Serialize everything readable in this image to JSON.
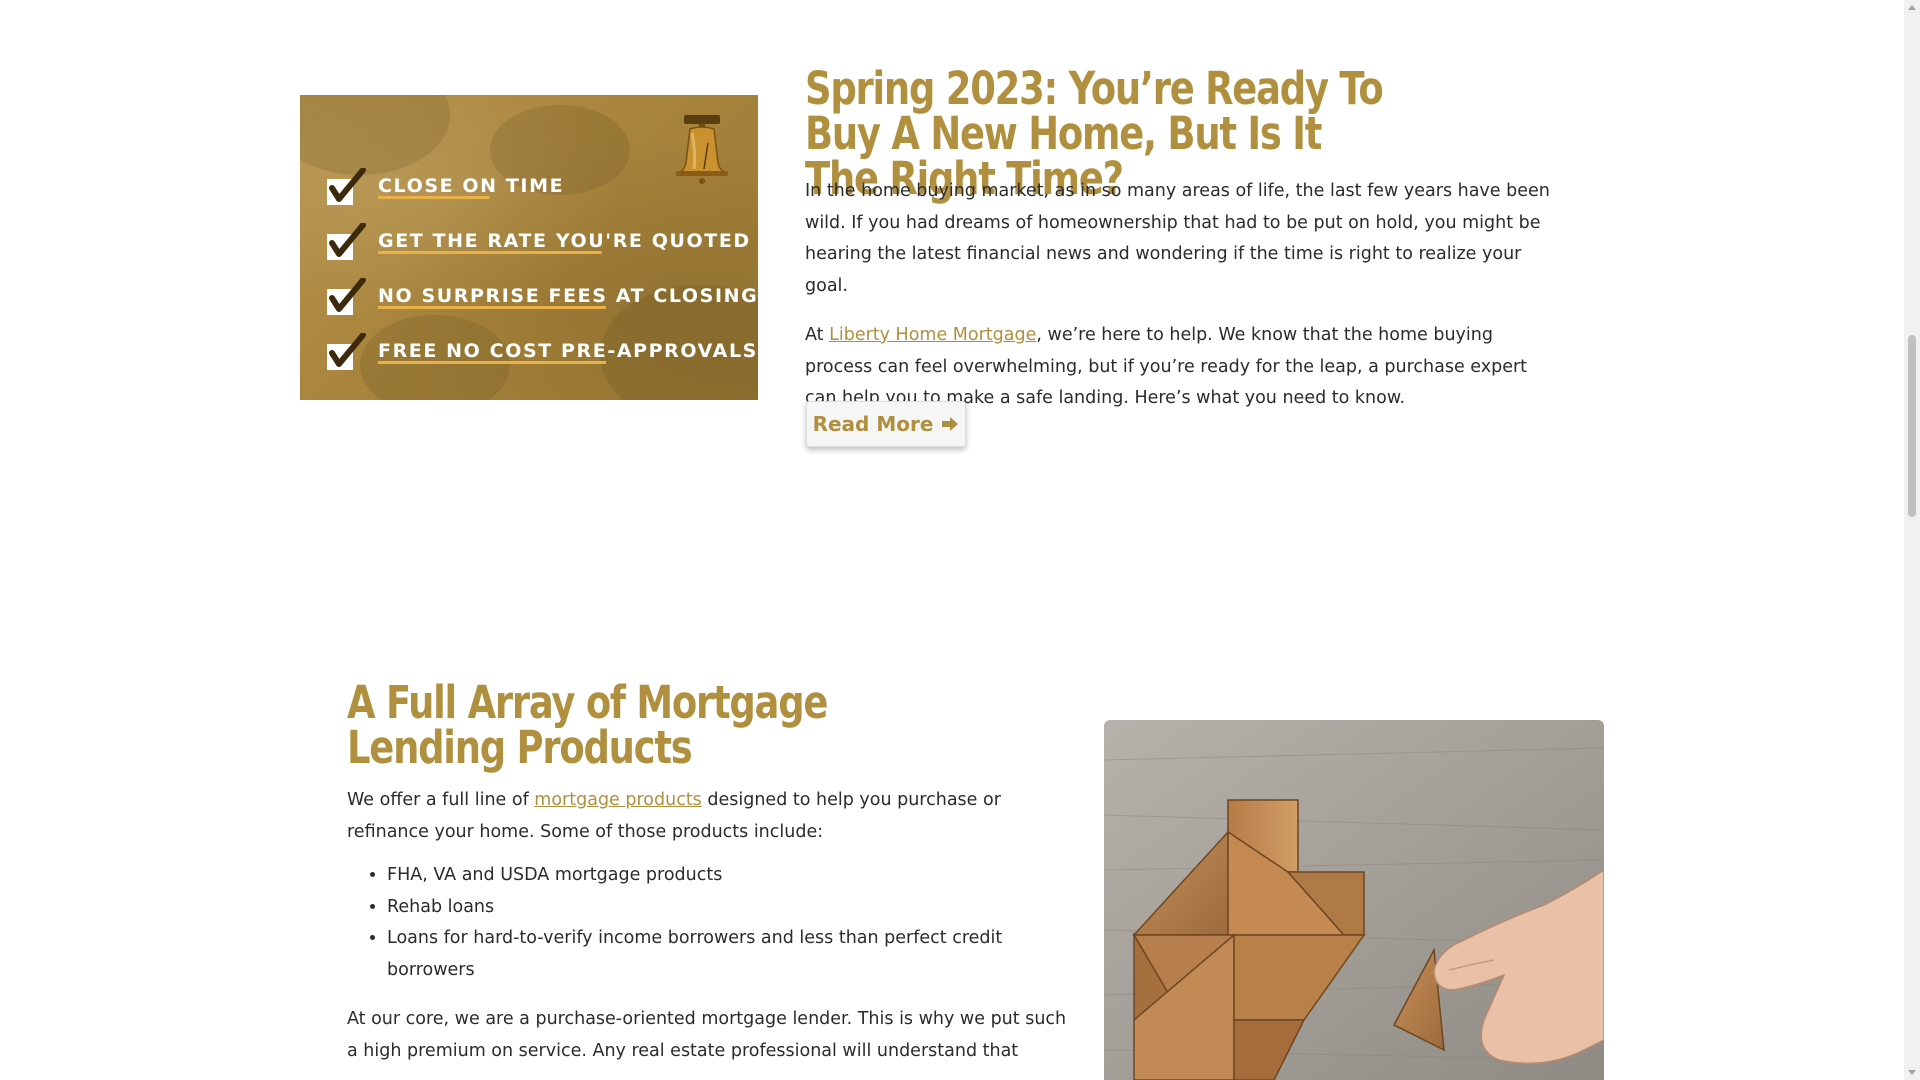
{
  "promo": {
    "items": [
      {
        "label": "CLOSE ON TIME"
      },
      {
        "label": "GET THE RATE YOU'RE QUOTED"
      },
      {
        "label": "NO SURPRISE FEES AT CLOSING"
      },
      {
        "label": "FREE NO COST PRE-APPROVALS"
      }
    ],
    "icon": "liberty-bell-icon"
  },
  "article": {
    "title": "Spring 2023: You’re Ready To Buy A New Home, But Is It The Right Time?",
    "paragraph1": "In the home buying market, as in so many areas of life, the last few years have been wild. If you had dreams of homeownership that had to be put on hold, you might be hearing the latest financial news and wondering if the time is right to realize your goal.",
    "paragraph2_prefix": "At ",
    "paragraph2_link": "Liberty Home Mortgage",
    "paragraph2_suffix": ", we’re here to help. We know that the home buying process can feel overwhelming, but if you’re ready for the leap, a purchase expert can help you to make a safe landing. Here’s what you need to know.",
    "read_more_label": "Read More"
  },
  "products": {
    "title": "A Full Array of Mortgage Lending Products",
    "intro_prefix": "We offer a full line of ",
    "intro_link": "mortgage products",
    "intro_suffix": " designed to help you purchase or refinance your home. Some of those products include:",
    "list": [
      "FHA, VA and USDA mortgage products",
      "Rehab loans",
      "Loans for hard-to-verify income borrowers and less than perfect credit borrowers"
    ],
    "closing": "At our core, we are a purchase-oriented mortgage lender. This is why we put such a high premium on service. Any real estate professional will understand that"
  },
  "colors": {
    "brand_gold": "#b08f3e",
    "banner_gold": "#a8843c",
    "underline_accent": "#e9b14a"
  }
}
